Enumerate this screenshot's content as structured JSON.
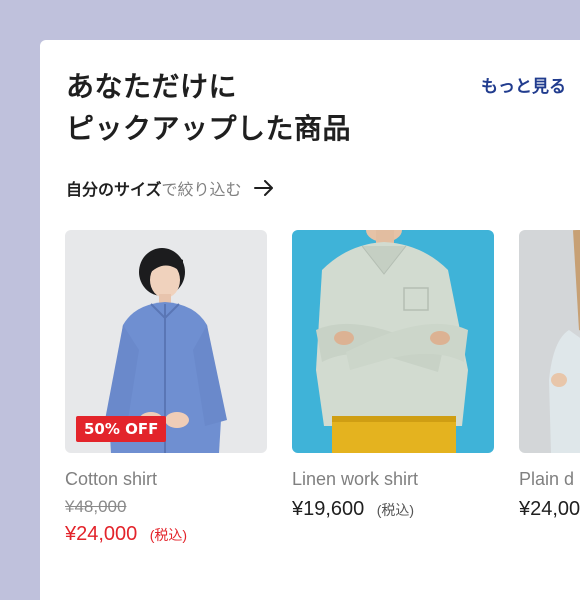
{
  "section": {
    "heading_line1": "あなただけに",
    "heading_line2": "ピックアップした商品",
    "see_more": "もっと見る",
    "filter_strong": "自分のサイズ",
    "filter_light": "で絞り込む",
    "arrow_icon": "arrow-right-icon"
  },
  "colors": {
    "background": "#bfc1dc",
    "accent": "#213c8e",
    "sale": "#e3242b"
  },
  "products": [
    {
      "name": "Cotton shirt",
      "badge": "50% OFF",
      "old_price": "¥48,000",
      "price": "¥24,000",
      "tax": "(税込)"
    },
    {
      "name": "Linen work shirt",
      "price": "¥19,600",
      "tax": "(税込)"
    },
    {
      "name": "Plain d",
      "price": "¥24,00"
    }
  ]
}
